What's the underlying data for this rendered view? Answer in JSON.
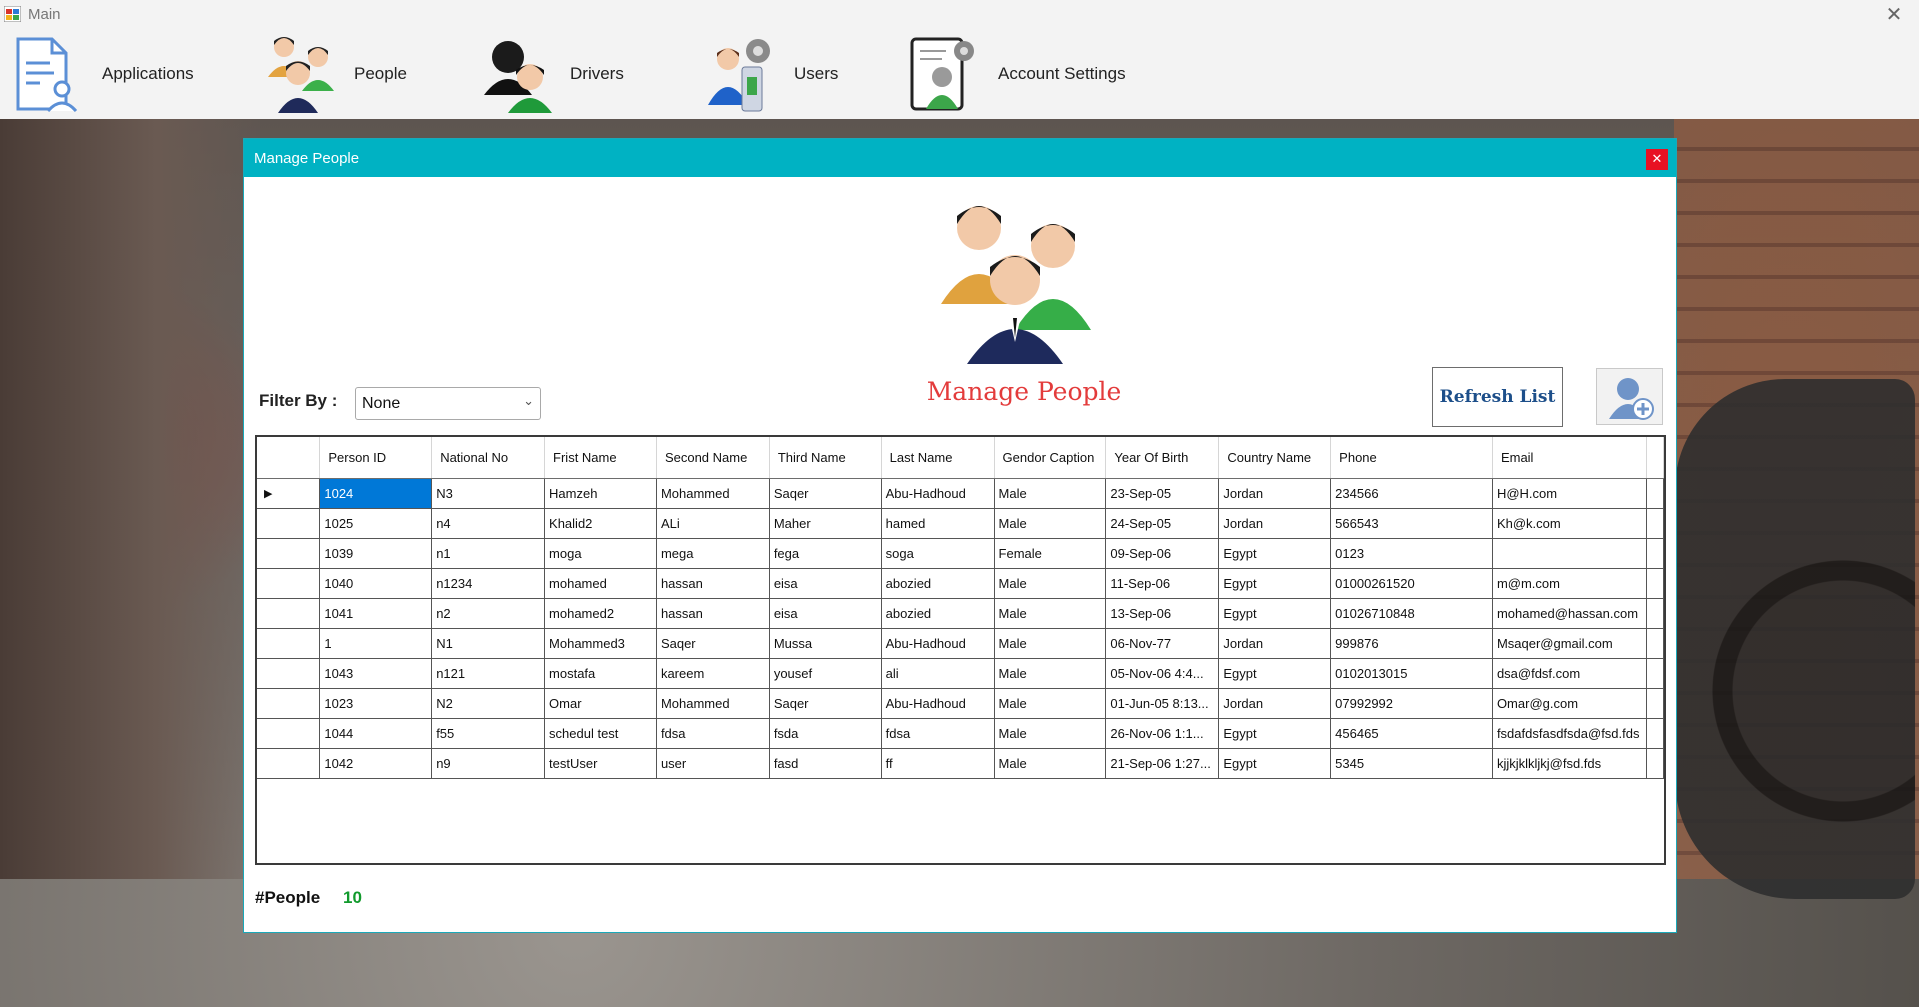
{
  "window": {
    "title": "Main"
  },
  "menu": [
    {
      "label": "Applications",
      "icon": "document-user-icon"
    },
    {
      "label": "People",
      "icon": "people-icon"
    },
    {
      "label": "Drivers",
      "icon": "drivers-icon"
    },
    {
      "label": "Users",
      "icon": "users-gear-icon"
    },
    {
      "label": "Account Settings",
      "icon": "account-settings-icon"
    }
  ],
  "dialog": {
    "title": "Manage People",
    "heading": "Manage People",
    "filter": {
      "label": "Filter By :",
      "value": "None"
    },
    "refresh_label": "Refresh List",
    "add_icon": "add-person-icon",
    "count_label": "#People",
    "count_value": "10"
  },
  "table": {
    "columns": [
      "Person ID",
      "National No",
      "Frist Name",
      "Second Name",
      "Third Name",
      "Last Name",
      "Gendor Caption",
      "Year Of Birth",
      "Country Name",
      "Phone",
      "Email"
    ],
    "rows": [
      [
        "1024",
        "N3",
        "Hamzeh",
        "Mohammed",
        "Saqer",
        "Abu-Hadhoud",
        "Male",
        "23-Sep-05",
        "Jordan",
        "234566",
        "H@H.com"
      ],
      [
        "1025",
        "n4",
        "Khalid2",
        "ALi",
        "Maher",
        "hamed",
        "Male",
        "24-Sep-05",
        "Jordan",
        "566543",
        "Kh@k.com"
      ],
      [
        "1039",
        "n1",
        "moga",
        "mega",
        "fega",
        "soga",
        "Female",
        "09-Sep-06",
        "Egypt",
        "0123",
        ""
      ],
      [
        "1040",
        "n1234",
        "mohamed",
        "hassan",
        "eisa",
        "abozied",
        "Male",
        "11-Sep-06",
        "Egypt",
        "01000261520",
        "m@m.com"
      ],
      [
        "1041",
        "n2",
        "mohamed2",
        "hassan",
        "eisa",
        "abozied",
        "Male",
        "13-Sep-06",
        "Egypt",
        "01026710848",
        "mohamed@hassan.com"
      ],
      [
        "1",
        "N1",
        "Mohammed3",
        "Saqer",
        "Mussa",
        "Abu-Hadhoud",
        "Male",
        "06-Nov-77",
        "Jordan",
        "999876",
        "Msaqer@gmail.com"
      ],
      [
        "1043",
        "n121",
        "mostafa",
        "kareem",
        "yousef",
        "ali",
        "Male",
        "05-Nov-06 4:4...",
        "Egypt",
        "0102013015",
        "dsa@fdsf.com"
      ],
      [
        "1023",
        "N2",
        "Omar",
        "Mohammed",
        "Saqer",
        "Abu-Hadhoud",
        "Male",
        "01-Jun-05 8:13...",
        "Jordan",
        "07992992",
        "Omar@g.com"
      ],
      [
        "1044",
        "f55",
        "schedul test",
        "fdsa",
        "fsda",
        "fdsa",
        "Male",
        "26-Nov-06 1:1...",
        "Egypt",
        "456465",
        "fsdafdsfasdfsda@fsd.fds"
      ],
      [
        "1042",
        "n9",
        "testUser",
        "user",
        "fasd",
        "ff",
        "Male",
        "21-Sep-06 1:27...",
        "Egypt",
        "5345",
        "kjjkjklkljkj@fsd.fds"
      ]
    ]
  },
  "colors": {
    "accent": "#00b2c3",
    "title_red": "#e33b3b",
    "count_green": "#119a2c",
    "selection": "#0078d7"
  }
}
